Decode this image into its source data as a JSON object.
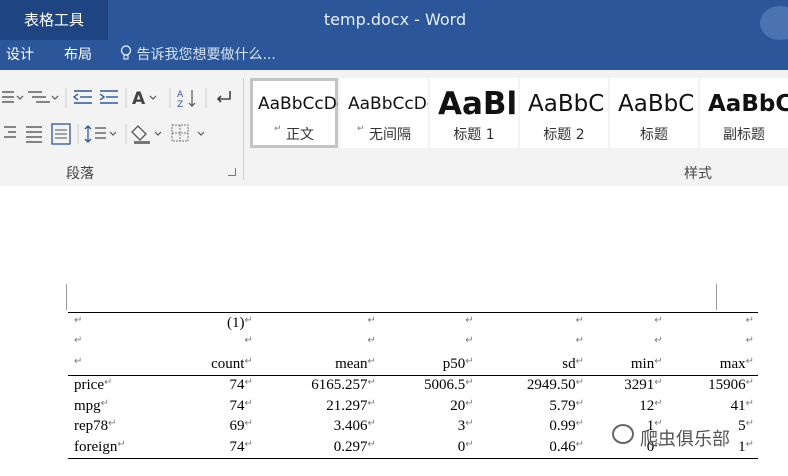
{
  "titlebar": {
    "context_tab": "表格工具",
    "doc_title": "temp.docx - Word"
  },
  "tabs": [
    "设计",
    "布局"
  ],
  "tell_me": "告诉我您想要做什么...",
  "ribbon": {
    "paragraph_group": "段落",
    "styles_group": "样式",
    "styles": [
      {
        "preview": "AaBbCcDc",
        "name": "正文",
        "selected": true
      },
      {
        "preview": "AaBbCcDc",
        "name": "无间隔",
        "selected": false
      },
      {
        "preview": "AaBl",
        "name": "标题 1",
        "selected": false
      },
      {
        "preview": "AaBbC",
        "name": "标题 2",
        "selected": false
      },
      {
        "preview": "AaBbC",
        "name": "标题",
        "selected": false
      },
      {
        "preview": "AaBbC",
        "name": "副标题",
        "selected": false
      }
    ]
  },
  "table": {
    "model_label": "(1)",
    "columns": [
      "count",
      "mean",
      "p50",
      "sd",
      "min",
      "max"
    ],
    "rows": [
      {
        "var": "price",
        "values": [
          "74",
          "6165.257",
          "5006.5",
          "2949.50",
          "3291",
          "15906"
        ]
      },
      {
        "var": "mpg",
        "values": [
          "74",
          "21.297",
          "20",
          "5.79",
          "12",
          "41"
        ]
      },
      {
        "var": "rep78",
        "values": [
          "69",
          "3.406",
          "3",
          "0.99",
          "1",
          "5"
        ]
      },
      {
        "var": "foreign",
        "values": [
          "74",
          "0.297",
          "0",
          "0.46",
          "0",
          "1"
        ]
      }
    ]
  },
  "watermark": "爬虫俱乐部"
}
